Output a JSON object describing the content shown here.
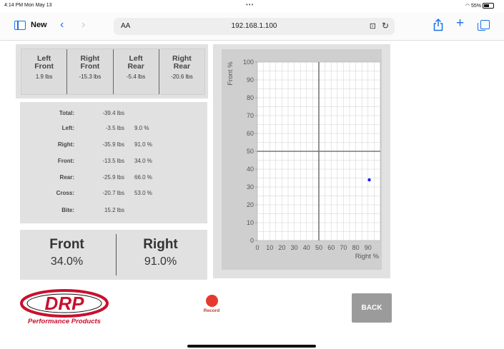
{
  "status_bar": {
    "time": "4:14 PM  Mon May 13",
    "dots": "•••",
    "battery": "55%"
  },
  "browser": {
    "new_label": "New",
    "text_size": "AA",
    "url": "192.168.1.100"
  },
  "corners": [
    {
      "label_line1": "Left",
      "label_line2": "Front",
      "value": "1.9 lbs"
    },
    {
      "label_line1": "Right",
      "label_line2": "Front",
      "value": "-15.3 lbs"
    },
    {
      "label_line1": "Left",
      "label_line2": "Rear",
      "value": "-5.4 lbs"
    },
    {
      "label_line1": "Right",
      "label_line2": "Rear",
      "value": "-20.6 lbs"
    }
  ],
  "stats": [
    {
      "label": "Total:",
      "value": "-39.4 lbs",
      "percent": ""
    },
    {
      "label": "Left:",
      "value": "-3.5 lbs",
      "percent": "9.0 %"
    },
    {
      "label": "Right:",
      "value": "-35.9 lbs",
      "percent": "91.0 %"
    },
    {
      "label": "Front:",
      "value": "-13.5 lbs",
      "percent": "34.0 %"
    },
    {
      "label": "Rear:",
      "value": "-25.9 lbs",
      "percent": "66.0 %"
    },
    {
      "label": "Cross:",
      "value": "-20.7 lbs",
      "percent": "53.0 %"
    },
    {
      "label": "Bite:",
      "value": "15.2 lbs",
      "percent": ""
    }
  ],
  "summary": {
    "front_title": "Front",
    "front_value": "34.0%",
    "right_title": "Right",
    "right_value": "91.0%"
  },
  "chart_data": {
    "type": "scatter",
    "xlabel": "Right %",
    "ylabel": "Front %",
    "xlim": [
      0,
      100
    ],
    "ylim": [
      0,
      100
    ],
    "x_ticks": [
      "0",
      "10",
      "20",
      "30",
      "40",
      "50",
      "60",
      "70",
      "80",
      "90"
    ],
    "y_ticks": [
      "0",
      "10",
      "20",
      "30",
      "40",
      "50",
      "60",
      "70",
      "80",
      "90",
      "100"
    ],
    "grid": true,
    "reference_lines": {
      "x": 50,
      "y": 50
    },
    "points": [
      {
        "x": 91,
        "y": 34
      }
    ],
    "point_color": "#1a1aff"
  },
  "footer": {
    "logo_text": "DRP",
    "logo_subtext": "Performance Products",
    "record_label": "Record",
    "back_label": "BACK"
  }
}
